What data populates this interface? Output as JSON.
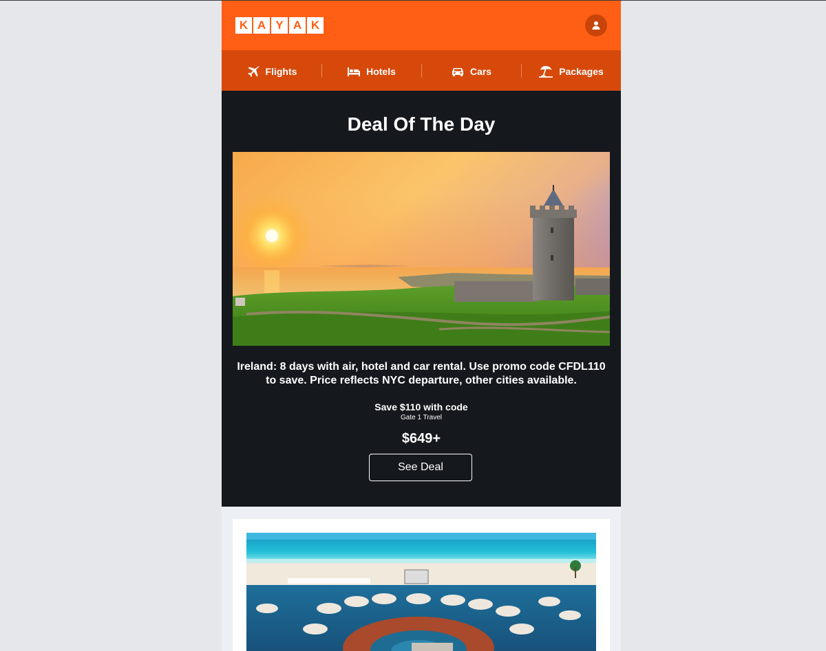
{
  "brand": {
    "letters": [
      "K",
      "A",
      "Y",
      "A",
      "K"
    ],
    "color": "#ff5f14"
  },
  "nav": {
    "items": [
      {
        "label": "Flights",
        "icon": "plane-icon"
      },
      {
        "label": "Hotels",
        "icon": "bed-icon"
      },
      {
        "label": "Cars",
        "icon": "car-icon"
      },
      {
        "label": "Packages",
        "icon": "beach-umbrella-icon"
      }
    ]
  },
  "deal": {
    "title": "Deal Of The Day",
    "description": "Ireland: 8 days with air, hotel and car rental. Use promo code CFDL110 to save. Price reflects NYC departure, other cities available.",
    "save_label": "Save $110 with code",
    "provider": "Gate 1 Travel",
    "price": "$649+",
    "button_label": "See Deal"
  },
  "colors": {
    "header": "#ff5f14",
    "nav": "#d6490b",
    "deal_background": "#15181d",
    "page_background": "#e5e7ea"
  }
}
